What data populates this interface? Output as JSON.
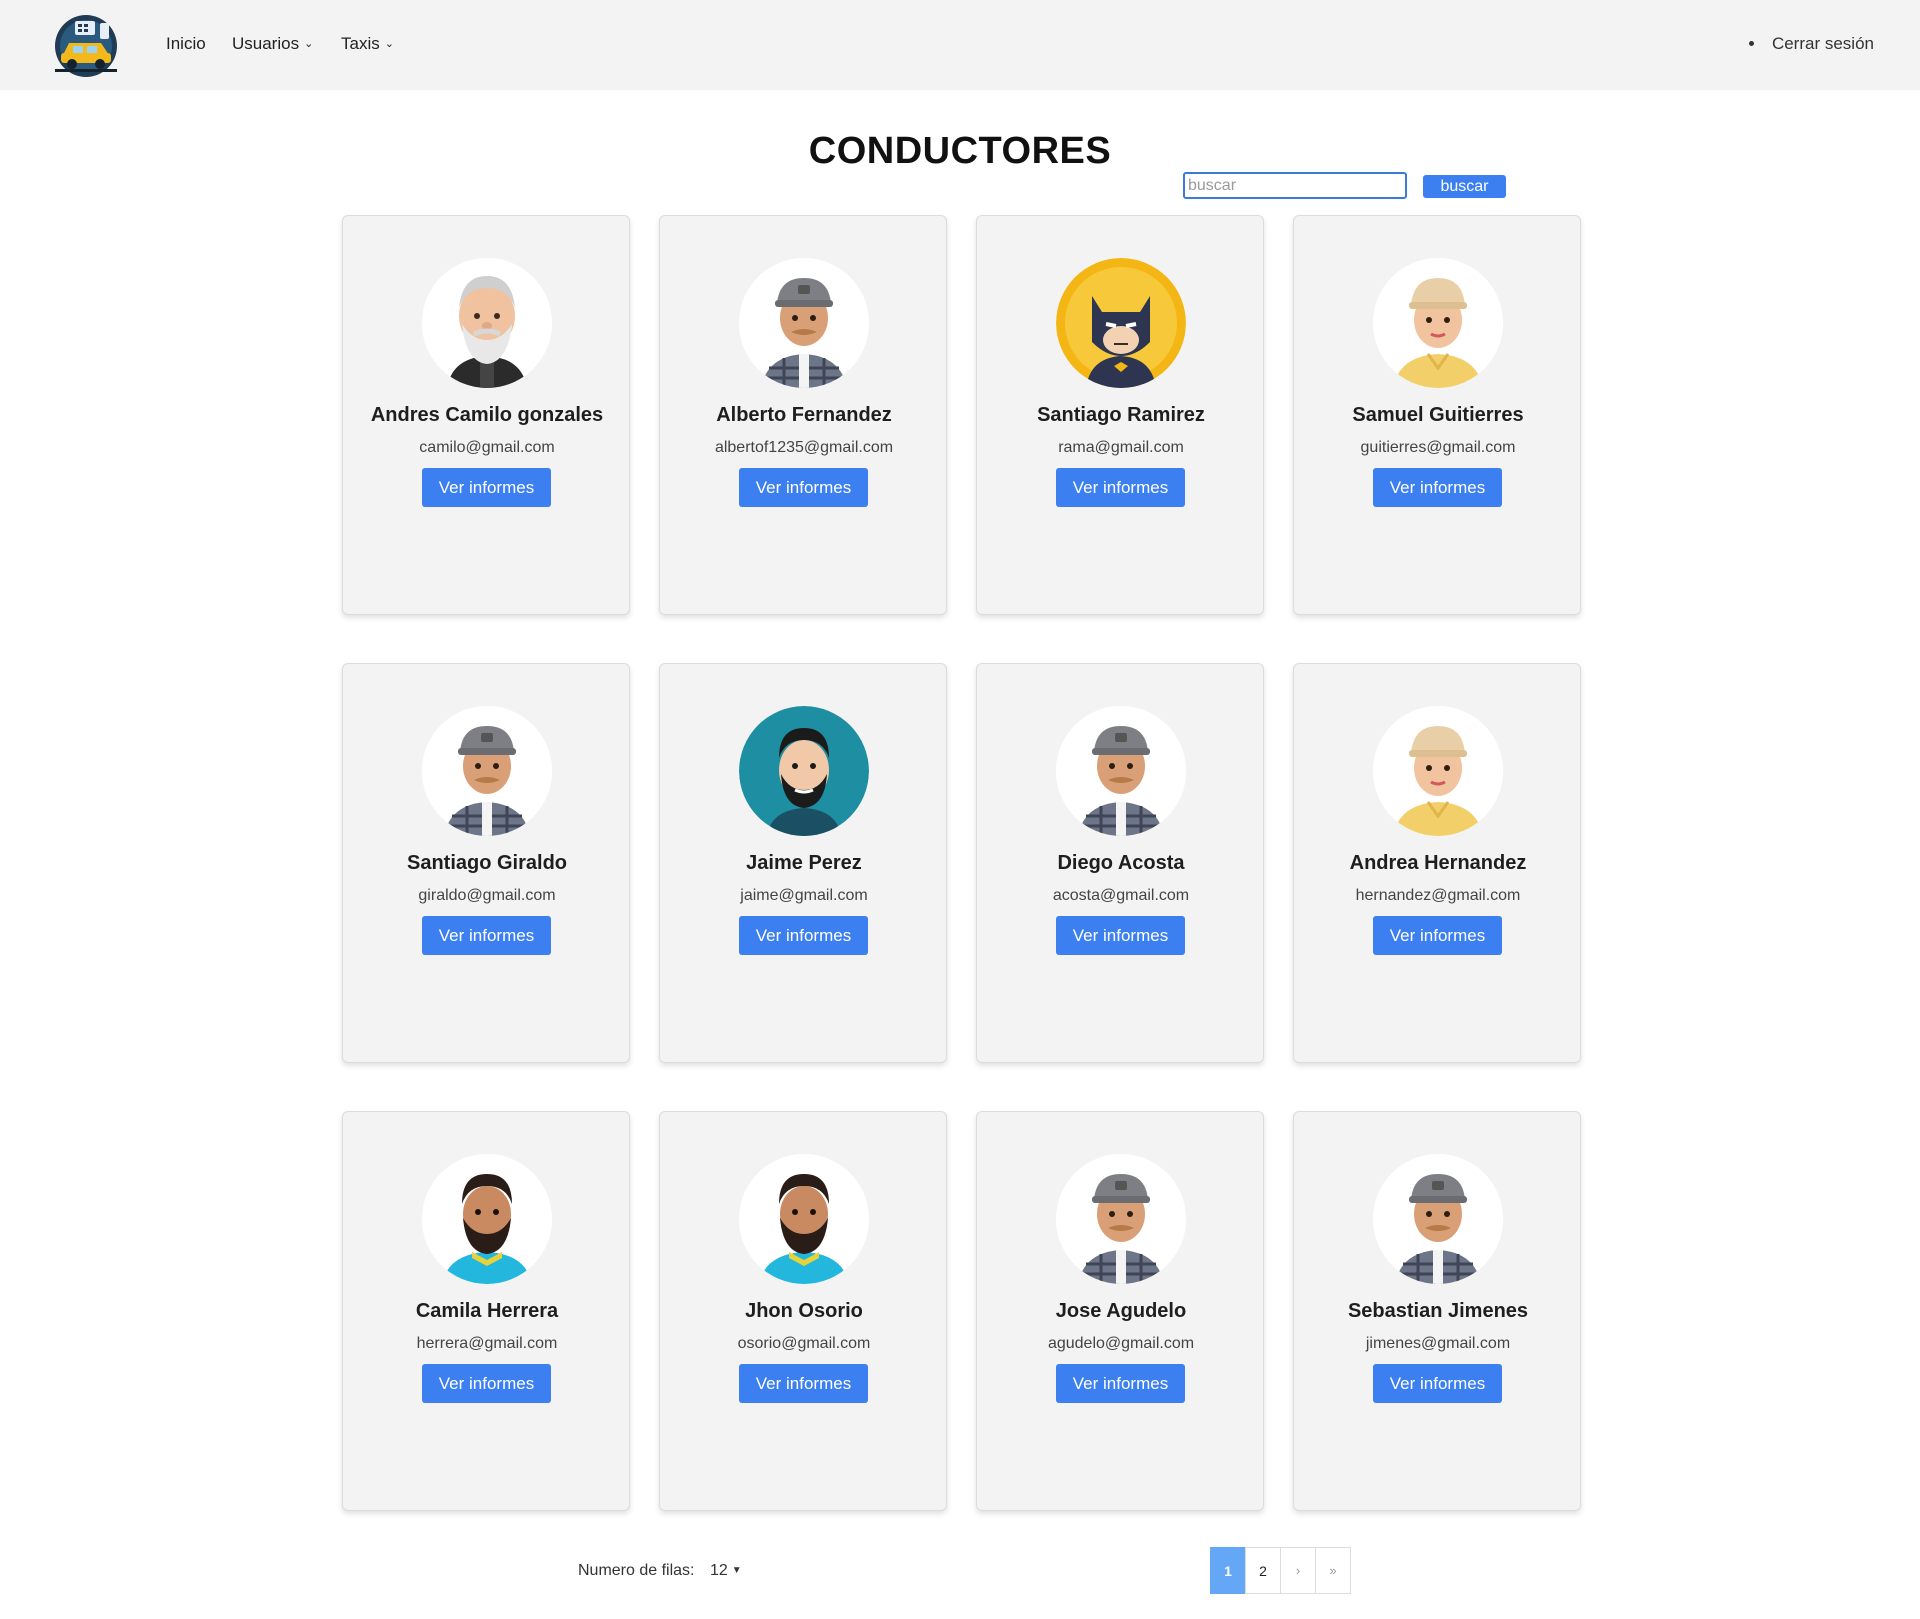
{
  "nav": {
    "inicio": "Inicio",
    "usuarios": "Usuarios",
    "taxis": "Taxis",
    "logout": "Cerrar sesión"
  },
  "page": {
    "title": "CONDUCTORES",
    "search_placeholder": "buscar",
    "search_button": "buscar"
  },
  "drivers": [
    {
      "name": "Andres Camilo gonzales",
      "email": "camilo@gmail.com",
      "button": "Ver informes",
      "avatar": "old-man-avatar"
    },
    {
      "name": "Alberto Fernandez",
      "email": "albertof1235@gmail.com",
      "button": "Ver informes",
      "avatar": "cap-man-avatar"
    },
    {
      "name": "Santiago Ramirez",
      "email": "rama@gmail.com",
      "button": "Ver informes",
      "avatar": "batman-avatar"
    },
    {
      "name": "Samuel Guitierres",
      "email": "guitierres@gmail.com",
      "button": "Ver informes",
      "avatar": "cap-woman-avatar"
    },
    {
      "name": "Santiago Giraldo",
      "email": "giraldo@gmail.com",
      "button": "Ver informes",
      "avatar": "cap-man-avatar"
    },
    {
      "name": "Jaime Perez",
      "email": "jaime@gmail.com",
      "button": "Ver informes",
      "avatar": "bearded-man-teal-avatar"
    },
    {
      "name": "Diego Acosta",
      "email": "acosta@gmail.com",
      "button": "Ver informes",
      "avatar": "cap-man-avatar"
    },
    {
      "name": "Andrea Hernandez",
      "email": "hernandez@gmail.com",
      "button": "Ver informes",
      "avatar": "cap-woman-avatar"
    },
    {
      "name": "Camila Herrera",
      "email": "herrera@gmail.com",
      "button": "Ver informes",
      "avatar": "bearded-man-avatar"
    },
    {
      "name": "Jhon Osorio",
      "email": "osorio@gmail.com",
      "button": "Ver informes",
      "avatar": "bearded-man-avatar"
    },
    {
      "name": "Jose Agudelo",
      "email": "agudelo@gmail.com",
      "button": "Ver informes",
      "avatar": "cap-man-avatar"
    },
    {
      "name": "Sebastian Jimenes",
      "email": "jimenes@gmail.com",
      "button": "Ver informes",
      "avatar": "cap-man-avatar"
    }
  ],
  "footer": {
    "rows_label": "Numero de filas:",
    "rows_value": "12",
    "pages": [
      "1",
      "2"
    ],
    "active_page": "1",
    "next": "›",
    "last": "»"
  },
  "colors": {
    "accent": "#3b7ff0",
    "active_page": "#64a7f7",
    "navbar": "#f3f3f3",
    "card": "#f3f3f3"
  }
}
